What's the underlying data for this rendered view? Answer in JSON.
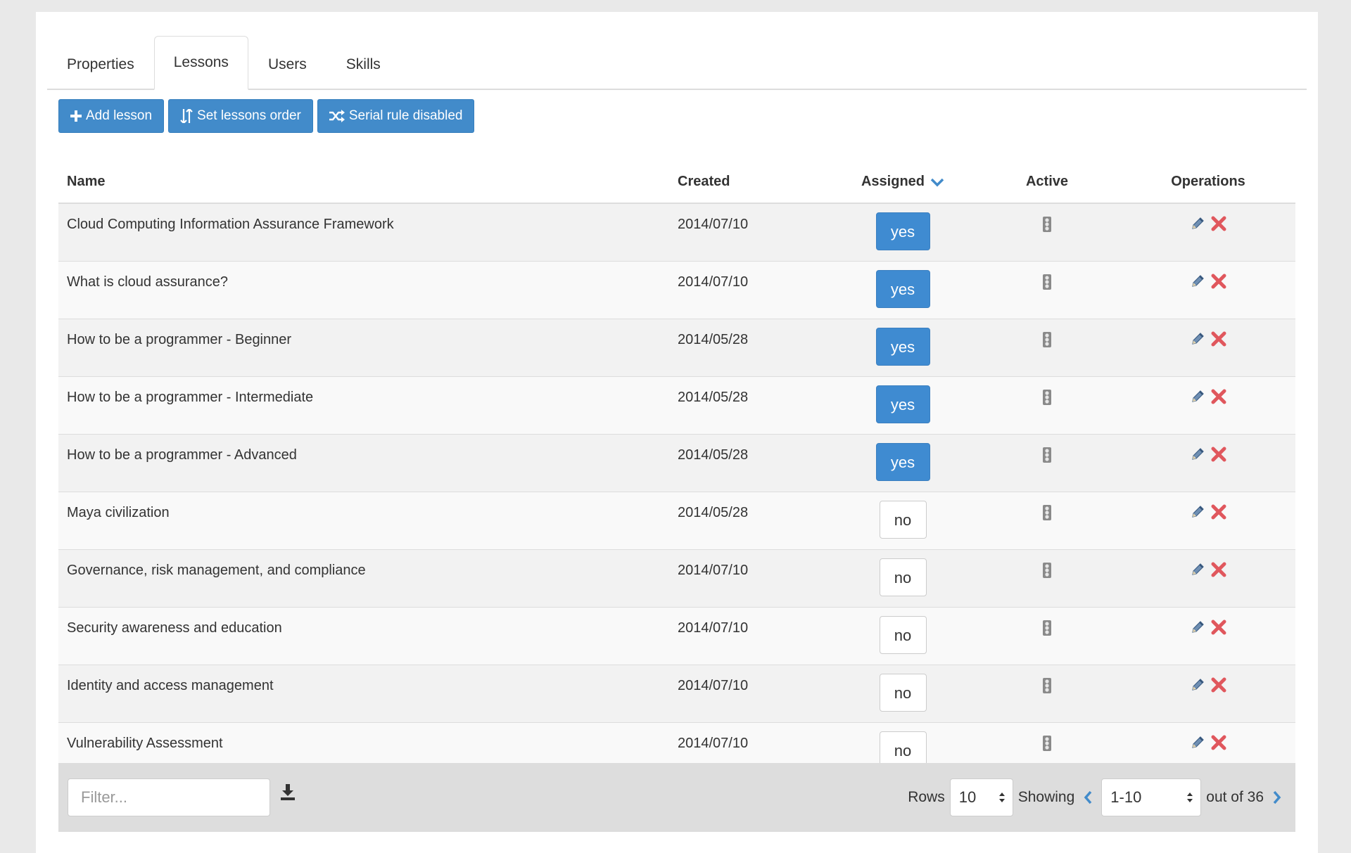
{
  "tabs": [
    "Properties",
    "Lessons",
    "Users",
    "Skills"
  ],
  "active_tab": "Lessons",
  "toolbar": {
    "add_lesson": "Add lesson",
    "set_order": "Set lessons order",
    "serial_rule": "Serial rule disabled"
  },
  "columns": {
    "name": "Name",
    "created": "Created",
    "assigned": "Assigned",
    "active": "Active",
    "operations": "Operations"
  },
  "rows": [
    {
      "name": "Cloud Computing Information Assurance Framework",
      "created": "2014/07/10",
      "assigned": "yes"
    },
    {
      "name": "What is cloud assurance?",
      "created": "2014/07/10",
      "assigned": "yes"
    },
    {
      "name": "How to be a programmer - Beginner",
      "created": "2014/05/28",
      "assigned": "yes"
    },
    {
      "name": "How to be a programmer - Intermediate",
      "created": "2014/05/28",
      "assigned": "yes"
    },
    {
      "name": "How to be a programmer - Advanced",
      "created": "2014/05/28",
      "assigned": "yes"
    },
    {
      "name": "Maya civilization",
      "created": "2014/05/28",
      "assigned": "no"
    },
    {
      "name": "Governance, risk management, and compliance",
      "created": "2014/07/10",
      "assigned": "no"
    },
    {
      "name": "Security awareness and education",
      "created": "2014/07/10",
      "assigned": "no"
    },
    {
      "name": "Identity and access management",
      "created": "2014/07/10",
      "assigned": "no"
    },
    {
      "name": "Vulnerability Assessment",
      "created": "2014/07/10",
      "assigned": "no"
    }
  ],
  "footer": {
    "filter_placeholder": "Filter...",
    "rows_label": "Rows",
    "rows_value": "10",
    "showing_label": "Showing",
    "range_value": "1-10",
    "out_of": "out of 36"
  },
  "colors": {
    "primary": "#428bca",
    "delete": "#d9534f"
  },
  "icons": {
    "add": "plus-icon",
    "order": "sort-icon",
    "serial": "shuffle-icon",
    "sort": "chevron-down-icon",
    "active": "traffic-light-icon",
    "edit": "pencil-icon",
    "delete": "x-icon",
    "download": "download-icon",
    "prev": "chevron-left-icon",
    "next": "chevron-right-icon"
  }
}
